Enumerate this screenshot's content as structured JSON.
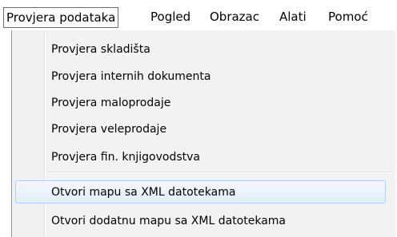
{
  "menubar": {
    "items": [
      {
        "label": "Provjera podataka",
        "open": true
      },
      {
        "label": "Pogled"
      },
      {
        "label": "Obrazac"
      },
      {
        "label": "Alati"
      },
      {
        "label": "Pomoć"
      }
    ]
  },
  "dropdown": {
    "items": [
      {
        "label": "Provjera skladišta"
      },
      {
        "label": "Provjera internih dokumenta"
      },
      {
        "label": "Provjera maloprodaje"
      },
      {
        "label": "Provjera veleprodaje"
      },
      {
        "label": "Provjera fin. knjigovodstva"
      },
      {
        "label": "Otvori mapu sa XML datotekama",
        "hovered": true
      },
      {
        "label": "Otvori dodatnu mapu sa XML datotekama"
      }
    ]
  },
  "colors": {
    "hover_border": "#aecff7",
    "hover_fill": "#e3eefb",
    "menu_background": "#f2f2f2"
  }
}
